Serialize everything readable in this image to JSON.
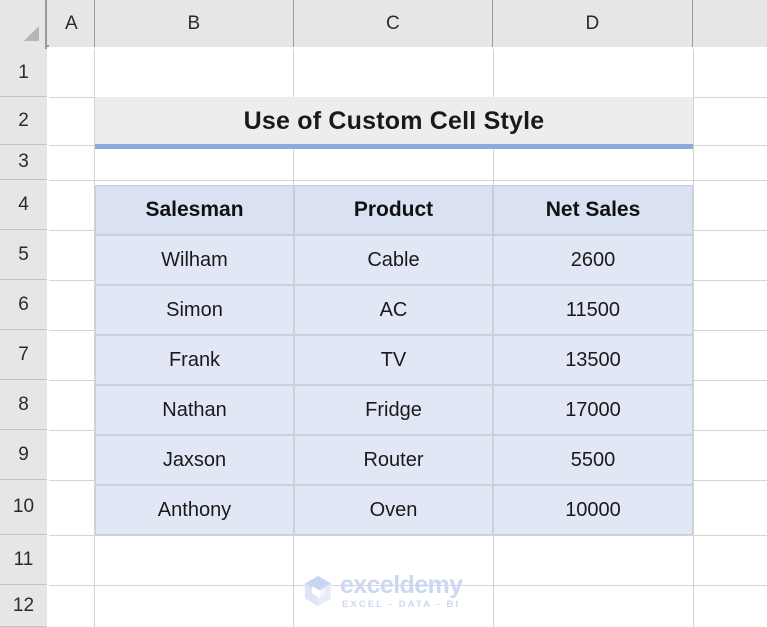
{
  "app": {
    "type": "spreadsheet",
    "select_all_label": "Select All"
  },
  "columns": {
    "headers": [
      "A",
      "B",
      "C",
      "D"
    ]
  },
  "rows": {
    "headers": [
      "1",
      "2",
      "3",
      "4",
      "5",
      "6",
      "7",
      "8",
      "9",
      "10",
      "11",
      "12"
    ]
  },
  "table": {
    "title": "Use of Custom Cell Style",
    "title_underline_color": "#8EA9DB",
    "title_background": "#EDEDED",
    "header_background": "#D9E1F2",
    "data_background": "#E1E7F5",
    "headers": [
      "Salesman",
      "Product",
      "Net Sales"
    ],
    "rows": [
      {
        "salesman": "Wilham",
        "product": "Cable",
        "net_sales": "2600"
      },
      {
        "salesman": "Simon",
        "product": "AC",
        "net_sales": "11500"
      },
      {
        "salesman": "Frank",
        "product": "TV",
        "net_sales": "13500"
      },
      {
        "salesman": "Nathan",
        "product": "Fridge",
        "net_sales": "17000"
      },
      {
        "salesman": "Jaxson",
        "product": "Router",
        "net_sales": "5500"
      },
      {
        "salesman": "Anthony",
        "product": "Oven",
        "net_sales": "10000"
      }
    ]
  },
  "watermark": {
    "name": "exceldemy",
    "tagline": "EXCEL - DATA - BI",
    "color": "#CCD7F0"
  }
}
